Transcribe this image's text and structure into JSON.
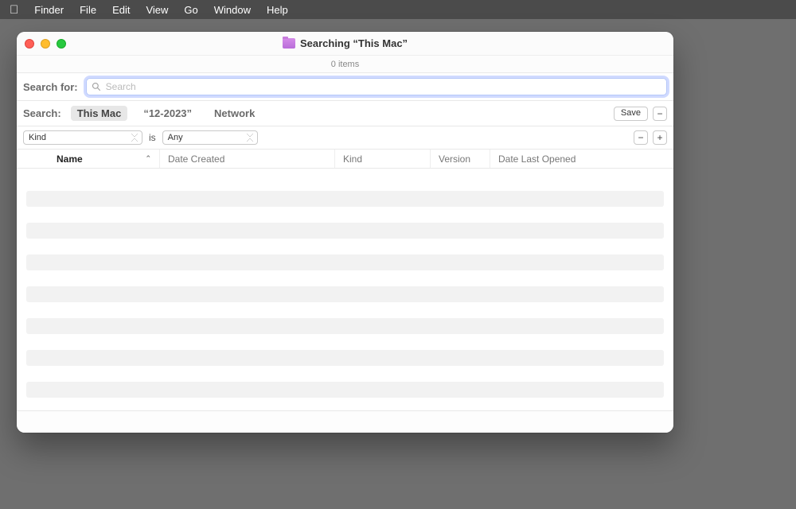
{
  "menubar": {
    "app": "Finder",
    "items": [
      "File",
      "Edit",
      "View",
      "Go",
      "Window",
      "Help"
    ]
  },
  "window": {
    "title": "Searching “This Mac”",
    "items_count_text": "0 items"
  },
  "search": {
    "label": "Search for:",
    "placeholder": "Search",
    "value": ""
  },
  "scope": {
    "label": "Search:",
    "options": [
      {
        "label": "This Mac",
        "selected": true
      },
      {
        "label": "“12-2023”",
        "selected": false
      },
      {
        "label": "Network",
        "selected": false
      }
    ],
    "save_label": "Save"
  },
  "criteria": {
    "attribute": "Kind",
    "operator": "is",
    "value": "Any"
  },
  "columns": {
    "name": "Name",
    "date_created": "Date Created",
    "kind": "Kind",
    "version": "Version",
    "date_last_opened": "Date Last Opened"
  },
  "results": {
    "rows": []
  }
}
